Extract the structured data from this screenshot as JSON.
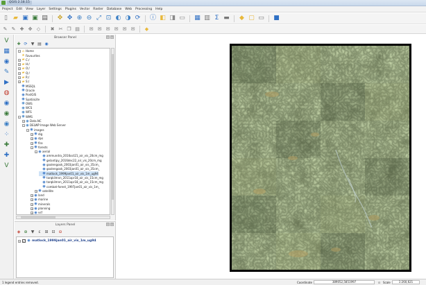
{
  "window": {
    "title": "QGIS 2.18.15"
  },
  "menus": [
    "Project",
    "Edit",
    "View",
    "Layer",
    "Settings",
    "Plugins",
    "Vector",
    "Raster",
    "Database",
    "Web",
    "Processing",
    "Help"
  ],
  "toolbar_icons": {
    "row1": [
      "new-project-icon",
      "open-project-icon",
      "save-project-icon",
      "save-as-icon",
      "print-composer-icon",
      "pan-icon",
      "pan-to-selection-icon",
      "zoom-in-icon",
      "zoom-out-icon",
      "zoom-full-icon",
      "zoom-layer-icon",
      "zoom-last-icon",
      "zoom-next-icon",
      "refresh-icon",
      "identify-icon",
      "select-icon",
      "deselect-icon",
      "measure-icon",
      "attribute-table-icon",
      "field-calculator-icon",
      "statistics-icon",
      "map-tips-icon",
      "annotation-icon",
      "text-annotation-icon",
      "bookmark-icon",
      "help-icon"
    ],
    "row2": [
      "edit-pencil-icon",
      "toggle-editing-icon",
      "add-feature-icon",
      "move-feature-icon",
      "node-tool-icon",
      "delete-selected-icon",
      "cut-icon",
      "copy-icon",
      "paste-icon",
      "label-icon",
      "label-pin-icon",
      "label-show-icon",
      "label-move-icon",
      "label-rotate-icon",
      "label-change-icon",
      "python-icon"
    ]
  },
  "left_tools": [
    "add-vector-layer-icon",
    "add-raster-layer-icon",
    "add-postgis-icon",
    "add-spatialite-icon",
    "add-mssql-icon",
    "add-oracle-icon",
    "add-wms-icon",
    "add-wcs-icon",
    "add-wfs-icon",
    "add-delimited-text-icon",
    "new-shapefile-icon",
    "new-spatialite-layer-icon",
    "new-gpx-icon"
  ],
  "browser": {
    "title": "Browser Panel",
    "tree": [
      {
        "indent": 0,
        "toggle": "−",
        "icon": "home",
        "label": "Home"
      },
      {
        "indent": 0,
        "toggle": "",
        "icon": "star",
        "label": "Favourites"
      },
      {
        "indent": 0,
        "toggle": "+",
        "icon": "folder",
        "label": "C:/"
      },
      {
        "indent": 0,
        "toggle": "+",
        "icon": "folder",
        "label": "H:/"
      },
      {
        "indent": 0,
        "toggle": "+",
        "icon": "folder",
        "label": "O:/"
      },
      {
        "indent": 0,
        "toggle": "+",
        "icon": "folder",
        "label": "Q:/"
      },
      {
        "indent": 0,
        "toggle": "+",
        "icon": "folder",
        "label": "R:/"
      },
      {
        "indent": 0,
        "toggle": "+",
        "icon": "folder",
        "label": "S:/"
      },
      {
        "indent": 0,
        "toggle": "",
        "icon": "db",
        "label": "MSSQL"
      },
      {
        "indent": 0,
        "toggle": "",
        "icon": "db",
        "label": "Oracle"
      },
      {
        "indent": 0,
        "toggle": "",
        "icon": "db",
        "label": "PostGIS"
      },
      {
        "indent": 0,
        "toggle": "",
        "icon": "db",
        "label": "SpatiaLite"
      },
      {
        "indent": 0,
        "toggle": "",
        "icon": "globe",
        "label": "OWS"
      },
      {
        "indent": 0,
        "toggle": "",
        "icon": "globe",
        "label": "WCS"
      },
      {
        "indent": 0,
        "toggle": "",
        "icon": "globe",
        "label": "WFS"
      },
      {
        "indent": 0,
        "toggle": "−",
        "icon": "globe",
        "label": "WMS"
      },
      {
        "indent": 1,
        "toggle": "+",
        "icon": "globe",
        "label": "Data.NC"
      },
      {
        "indent": 1,
        "toggle": "−",
        "icon": "globe",
        "label": "DELWP Image Web Server"
      },
      {
        "indent": 2,
        "toggle": "−",
        "icon": "layers",
        "label": "images"
      },
      {
        "indent": 3,
        "toggle": "+",
        "icon": "layers",
        "label": "dig"
      },
      {
        "indent": 3,
        "toggle": "+",
        "icon": "layers",
        "label": "dps"
      },
      {
        "indent": 3,
        "toggle": "+",
        "icon": "layers",
        "label": "fire"
      },
      {
        "indent": 3,
        "toggle": "−",
        "icon": "layers",
        "label": "forests"
      },
      {
        "indent": 4,
        "toggle": "−",
        "icon": "layers",
        "label": "aerial"
      },
      {
        "indent": 5,
        "toggle": "",
        "icon": "layers",
        "label": "ammundra_2016oct21_air_vis_20cm_mg"
      },
      {
        "indent": 5,
        "toggle": "",
        "icon": "layers",
        "label": "gelantipy_2016dec22_air_vis_20cm_mg"
      },
      {
        "indent": 5,
        "toggle": "",
        "icon": "layers",
        "label": "goolengook_2003jan01_air_vis_35cm_"
      },
      {
        "indent": 5,
        "toggle": "",
        "icon": "layers",
        "label": "goolengook_2003jan01_air_vis_35cm_"
      },
      {
        "indent": 5,
        "toggle": "",
        "icon": "layers",
        "label": "matlock_1999jan01_air_vis_1m_ug94"
      },
      {
        "indent": 5,
        "toggle": "",
        "icon": "layers",
        "label": "tarqkilmnn_2011apr18_air_vis_15cm_mg"
      },
      {
        "indent": 5,
        "toggle": "",
        "icon": "layers",
        "label": "tarqkilmnn_2011apr18_air_vis_15cm_mg"
      },
      {
        "indent": 5,
        "toggle": "",
        "icon": "layers",
        "label": "combat-forest_1997jan01_air_vis_1m_"
      },
      {
        "indent": 4,
        "toggle": "+",
        "icon": "layers",
        "label": "satellite"
      },
      {
        "indent": 3,
        "toggle": "+",
        "icon": "layers",
        "label": "land"
      },
      {
        "indent": 3,
        "toggle": "+",
        "icon": "layers",
        "label": "marine"
      },
      {
        "indent": 3,
        "toggle": "+",
        "icon": "layers",
        "label": "minerals"
      },
      {
        "indent": 3,
        "toggle": "+",
        "icon": "layers",
        "label": "planning"
      },
      {
        "indent": 3,
        "toggle": "+",
        "icon": "layers",
        "label": "vsf"
      }
    ],
    "selected_index": 28
  },
  "layers_panel": {
    "title": "Layers Panel",
    "items": [
      {
        "label": "matlock_1999jan01_air_vis_1m_ug94",
        "checked": true
      }
    ]
  },
  "status": {
    "message": "1 legend entries removed.",
    "coordinate_label": "Coordinate",
    "coordinate": "389052,5851997",
    "scale_label": "Scale",
    "scale": "1:260,621"
  },
  "colors": {
    "accent_blue": "#2e6fc4",
    "folder_yellow": "#e8b83a",
    "imagery_green": "#4a5a36"
  }
}
